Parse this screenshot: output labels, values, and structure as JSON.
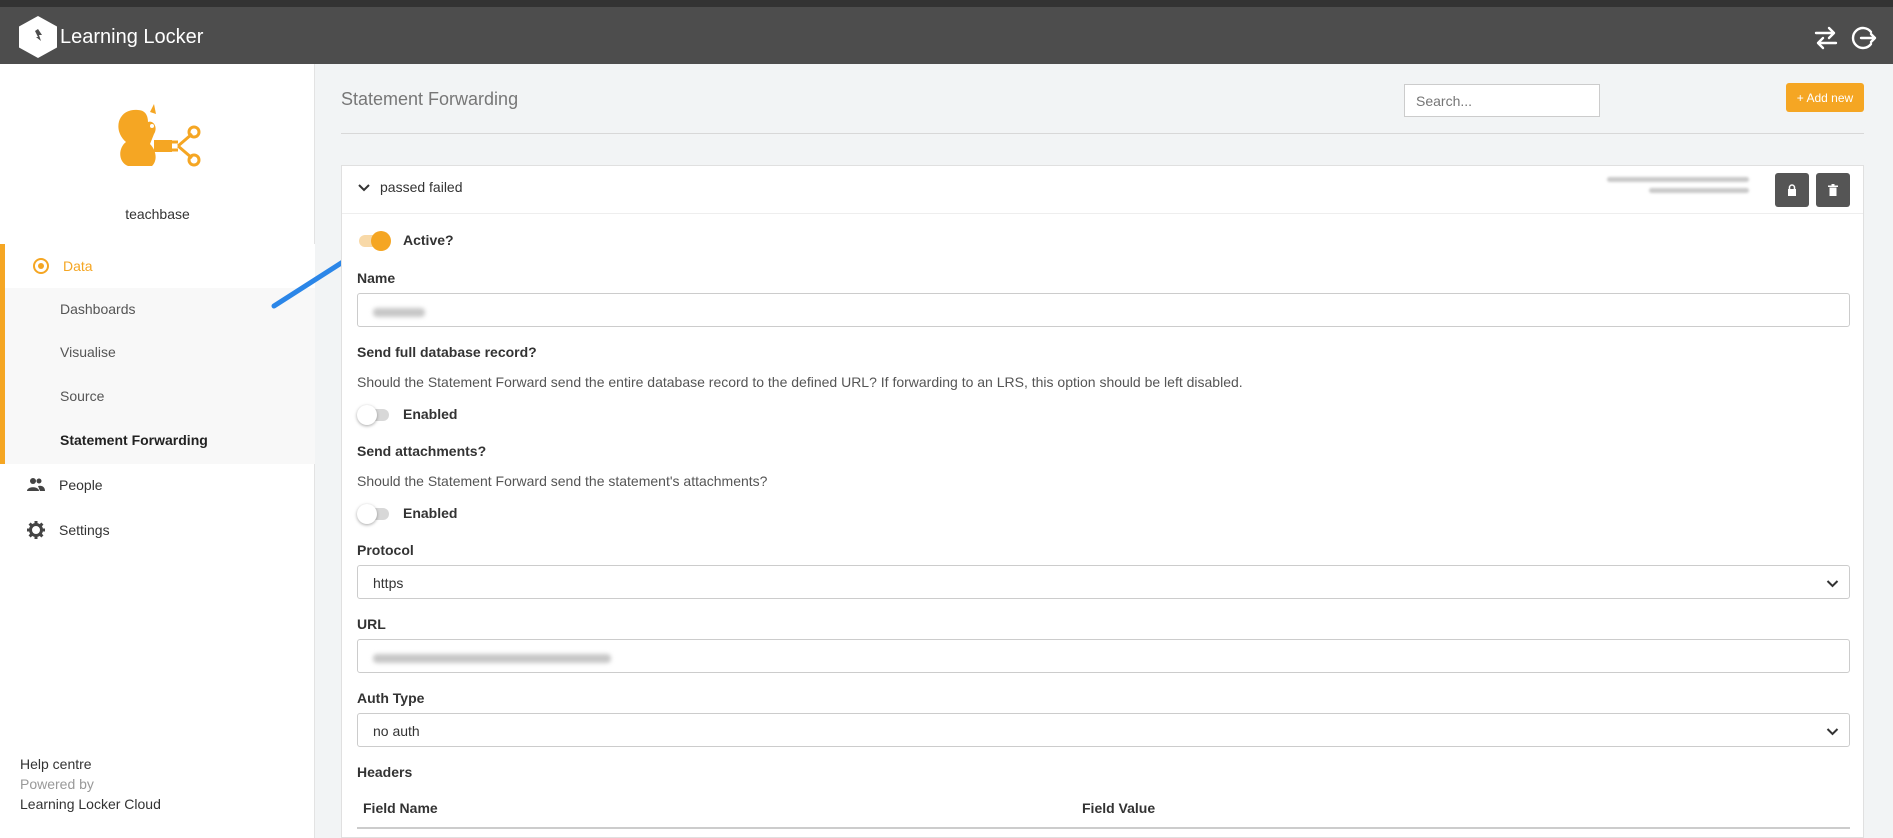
{
  "app": {
    "name": "Learning Locker"
  },
  "sidebar": {
    "org_name": "teachbase",
    "data_label": "Data",
    "sub_items": [
      "Dashboards",
      "Visualise",
      "Source",
      "Statement Forwarding"
    ],
    "people_label": "People",
    "settings_label": "Settings",
    "help": "Help centre",
    "powered_by": "Powered by",
    "cloud": "Learning Locker Cloud"
  },
  "header": {
    "title": "Statement Forwarding",
    "search_placeholder": "Search...",
    "add_label": "+ Add new"
  },
  "panel": {
    "title": "passed failed",
    "active_label": "Active?",
    "active_state": true,
    "name_label": "Name",
    "full_record_label": "Send full database record?",
    "full_record_desc": "Should the Statement Forward send the entire database record to the defined URL? If forwarding to an LRS, this option should be left disabled.",
    "full_record_toggle": "Enabled",
    "full_record_state": false,
    "attachments_label": "Send attachments?",
    "attachments_desc": "Should the Statement Forward send the statement's attachments?",
    "attachments_toggle": "Enabled",
    "attachments_state": false,
    "protocol_label": "Protocol",
    "protocol_value": "https",
    "url_label": "URL",
    "auth_label": "Auth Type",
    "auth_value": "no auth",
    "headers_label": "Headers",
    "col_field_name": "Field Name",
    "col_field_value": "Field Value"
  },
  "icons": {
    "logo": "learning-locker-logo-icon",
    "switch": "swap-arrows-icon",
    "logout": "logout-icon",
    "lock": "lock-icon",
    "trash": "trash-icon"
  },
  "colors": {
    "accent": "#f5a623",
    "topbar": "#4d4d4d",
    "annotation_arrow": "#2b86e8"
  }
}
